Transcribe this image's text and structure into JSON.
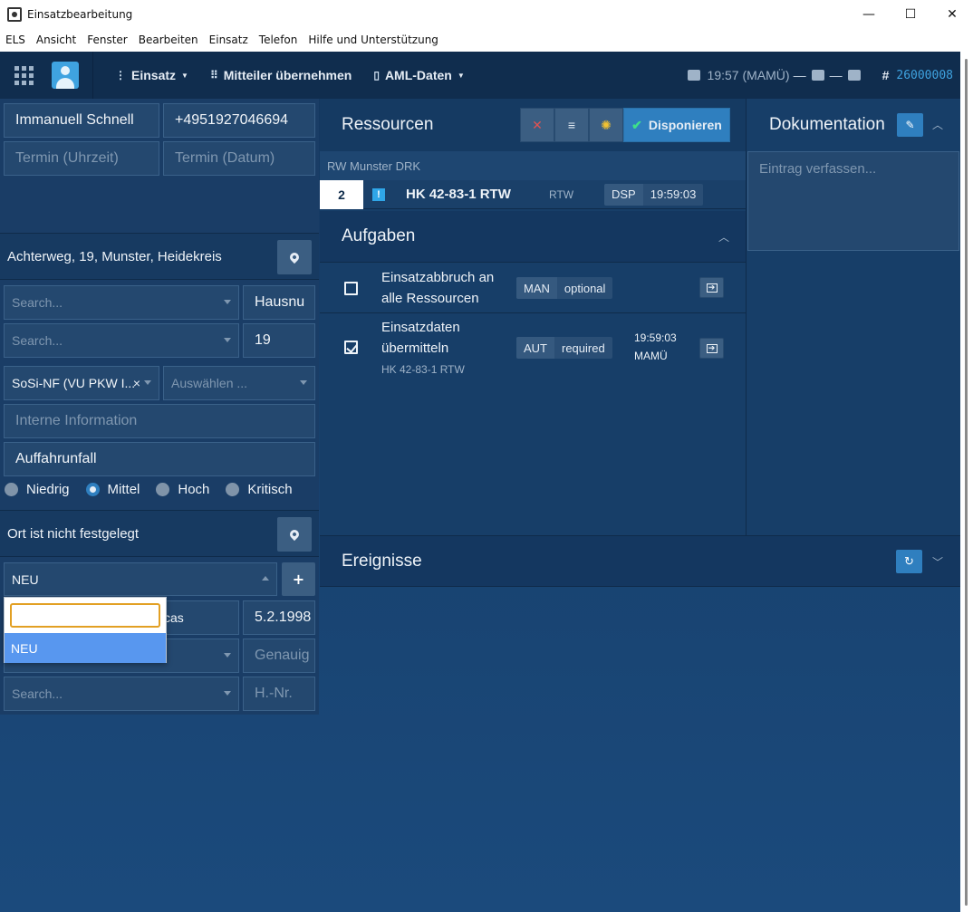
{
  "window": {
    "title": "Einsatzbearbeitung",
    "min": "—",
    "max": "☐",
    "close": "✕"
  },
  "menu": [
    "ELS",
    "Ansicht",
    "Fenster",
    "Bearbeiten",
    "Einsatz",
    "Telefon",
    "Hilfe und Unterstützung"
  ],
  "nav": {
    "einsatz": "Einsatz",
    "mitteiler": "Mitteiler übernehmen",
    "aml": "AML-Daten",
    "status_time": "19:57 (MAMÜ)",
    "hash": "#",
    "incident_id": "26000008"
  },
  "left": {
    "caller_name": "Immanuell Schnell",
    "caller_phone": "+4951927046694",
    "termin_time_ph": "Termin (Uhrzeit)",
    "termin_date_ph": "Termin (Datum)",
    "address": "Achterweg, 19, Munster, Heidekreis",
    "search1_ph": "Search...",
    "hausnr1": "Hausnu",
    "search2_ph": "Search...",
    "hausnr2": "19",
    "keyword": "SoSi-NF (VU PKW I...",
    "keyword_clear": "×",
    "auswaehlen_ph": "Auswählen ...",
    "interne_ph": "Interne Information",
    "description": "Auffahrunfall",
    "priorities": [
      "Niedrig",
      "Mittel",
      "Hoch",
      "Kritisch"
    ],
    "priority_selected": "Mittel",
    "location2": "Ort ist nicht festgelegt",
    "patient_select": "NEU",
    "plus": "+",
    "patient_name_tail": "cas",
    "birthdate": "5.2.1998",
    "genauig_ph": "Genauig",
    "search3_ph": "Search...",
    "hnr_ph": "H.-Nr.",
    "dropdown_option": "NEU"
  },
  "ressourcen": {
    "title": "Ressourcen",
    "cancel_icon": "✕",
    "list_icon": "≡",
    "bulb_icon": "bulb-icon",
    "disponieren": "Disponieren",
    "group": "RW Munster DRK",
    "row": {
      "num": "2",
      "excl": "!",
      "name": "HK 42-83-1 RTW",
      "type": "RTW",
      "status": "DSP",
      "time": "19:59:03"
    }
  },
  "aufgaben": {
    "title": "Aufgaben",
    "tasks": [
      {
        "line1": "Einsatzabbruch an",
        "line2": "alle Ressourcen",
        "sub": "",
        "mode": "MAN",
        "req": "optional",
        "time": "",
        "user": "",
        "checked": false
      },
      {
        "line1": "Einsatzdaten",
        "line2": "übermitteln",
        "sub": "HK 42-83-1 RTW",
        "mode": "AUT",
        "req": "required",
        "time": "19:59:03",
        "user": "MAMÜ",
        "checked": true
      }
    ]
  },
  "dokumentation": {
    "title": "Dokumentation",
    "placeholder": "Eintrag verfassen..."
  },
  "ereignisse": {
    "title": "Ereignisse"
  },
  "colors": {
    "accent": "#2f7fbf",
    "panel": "#173e68",
    "field": "#24486f",
    "highlight": "#5897ef",
    "focus": "#e2a024"
  }
}
